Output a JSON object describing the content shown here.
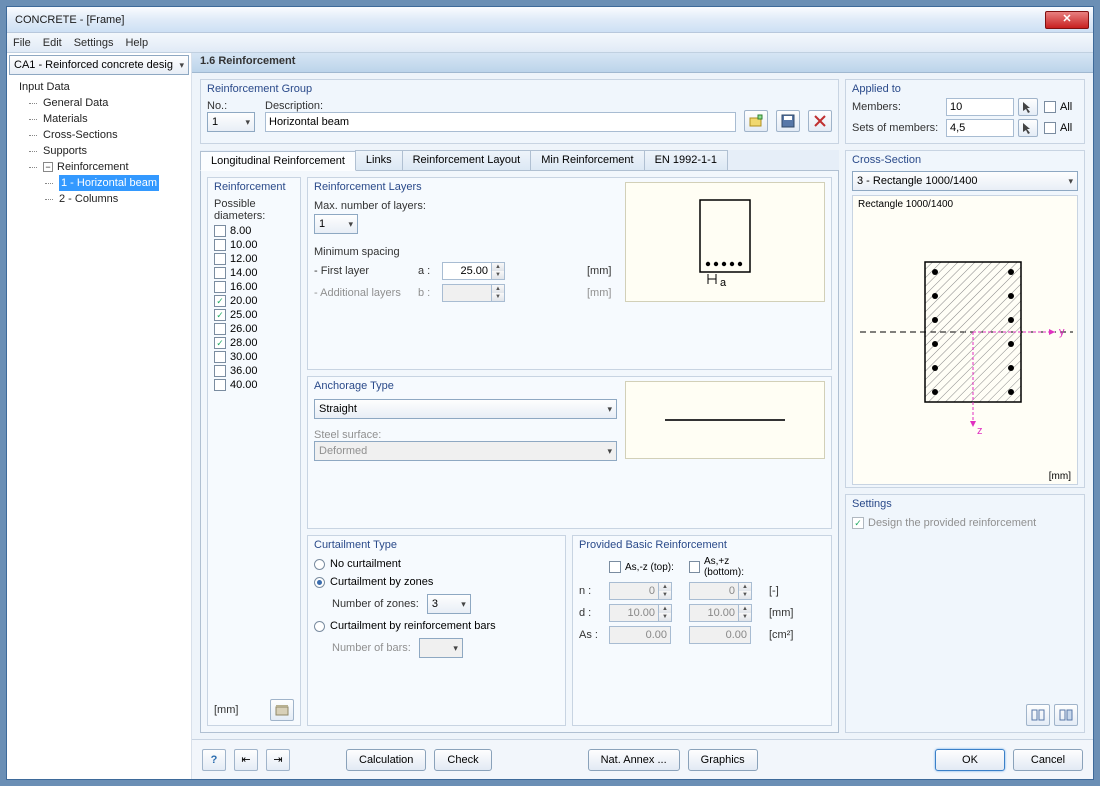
{
  "title": "CONCRETE - [Frame]",
  "menu": {
    "file": "File",
    "edit": "Edit",
    "settings": "Settings",
    "help": "Help"
  },
  "caseCombo": "CA1 - Reinforced concrete desig",
  "tree": {
    "root": "Input Data",
    "items": [
      "General Data",
      "Materials",
      "Cross-Sections",
      "Supports"
    ],
    "reinf": "Reinforcement",
    "sub1": "1 - Horizontal beam",
    "sub2": "2 - Columns"
  },
  "header": "1.6 Reinforcement",
  "reinfGroup": {
    "title": "Reinforcement Group",
    "noLabel": "No.:",
    "noValue": "1",
    "descLabel": "Description:",
    "descValue": "Horizontal beam"
  },
  "appliedTo": {
    "title": "Applied to",
    "membersLabel": "Members:",
    "membersValue": "10",
    "setsLabel": "Sets of members:",
    "setsValue": "4,5",
    "all": "All"
  },
  "tabs": [
    "Longitudinal Reinforcement",
    "Links",
    "Reinforcement Layout",
    "Min Reinforcement",
    "EN 1992-1-1"
  ],
  "reinf": {
    "title": "Reinforcement",
    "possible": "Possible diameters:",
    "diameters": [
      {
        "v": "8.00",
        "c": false
      },
      {
        "v": "10.00",
        "c": false
      },
      {
        "v": "12.00",
        "c": false
      },
      {
        "v": "14.00",
        "c": false
      },
      {
        "v": "16.00",
        "c": false
      },
      {
        "v": "20.00",
        "c": true
      },
      {
        "v": "25.00",
        "c": true
      },
      {
        "v": "26.00",
        "c": false
      },
      {
        "v": "28.00",
        "c": true
      },
      {
        "v": "30.00",
        "c": false
      },
      {
        "v": "36.00",
        "c": false
      },
      {
        "v": "40.00",
        "c": false
      }
    ],
    "unit": "[mm]"
  },
  "layers": {
    "title": "Reinforcement Layers",
    "maxLabel": "Max. number of layers:",
    "maxValue": "1",
    "minSpacing": "Minimum spacing",
    "firstLabel": "- First layer",
    "a": "a :",
    "aValue": "25.00",
    "addLabel": "- Additional layers",
    "b": "b :",
    "mm": "[mm]"
  },
  "anchorage": {
    "title": "Anchorage Type",
    "value": "Straight",
    "surfLabel": "Steel surface:",
    "surfValue": "Deformed"
  },
  "curtail": {
    "title": "Curtailment Type",
    "none": "No curtailment",
    "zones": "Curtailment by zones",
    "zonesNum": "Number of zones:",
    "zonesVal": "3",
    "bars": "Curtailment by reinforcement bars",
    "barsNum": "Number of bars:"
  },
  "provided": {
    "title": "Provided Basic Reinforcement",
    "topLabel": "As,-z (top):",
    "botLabel": "As,+z (bottom):",
    "n": "n :",
    "nVal1": "0",
    "nVal2": "0",
    "nu": "[-]",
    "d": "d :",
    "dVal1": "10.00",
    "dVal2": "10.00",
    "du": "[mm]",
    "as": "As :",
    "asVal1": "0.00",
    "asVal2": "0.00",
    "asu": "[cm²]"
  },
  "crossSection": {
    "title": "Cross-Section",
    "combo": "3 - Rectangle 1000/1400",
    "caption": "Rectangle 1000/1400",
    "unit": "[mm]"
  },
  "settingsGroup": {
    "title": "Settings",
    "design": "Design the provided reinforcement"
  },
  "buttons": {
    "calculation": "Calculation",
    "check": "Check",
    "natAnnex": "Nat. Annex ...",
    "graphics": "Graphics",
    "ok": "OK",
    "cancel": "Cancel"
  }
}
